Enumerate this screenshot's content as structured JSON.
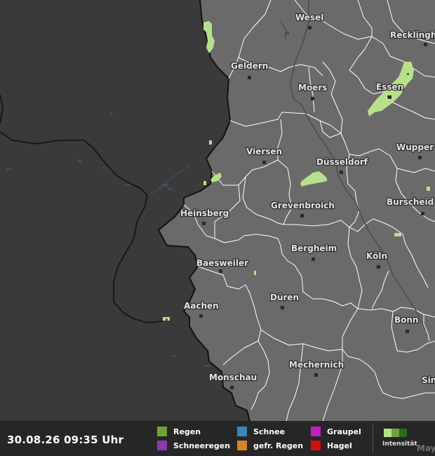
{
  "cities": [
    {
      "name": "Wesel"
    },
    {
      "name": "Recklingh"
    },
    {
      "name": "Geldern"
    },
    {
      "name": "Moers"
    },
    {
      "name": "Essen"
    },
    {
      "name": "Viersen"
    },
    {
      "name": "Düsseldorf"
    },
    {
      "name": "Wupper"
    },
    {
      "name": "Heinsberg"
    },
    {
      "name": "Grevenbroich"
    },
    {
      "name": "Burscheid"
    },
    {
      "name": "Bergheim"
    },
    {
      "name": "Köln"
    },
    {
      "name": "Baesweiler"
    },
    {
      "name": "Aachen"
    },
    {
      "name": "Düren"
    },
    {
      "name": "Bonn"
    },
    {
      "name": "Mechernich"
    },
    {
      "name": "Sin"
    },
    {
      "name": "Monschau"
    }
  ],
  "footer": {
    "timestamp": "30.08.26 09:35 Uhr",
    "legend": [
      {
        "label": "Regen",
        "color": "#6fa23a"
      },
      {
        "label": "Schnee",
        "color": "#3a86b8"
      },
      {
        "label": "Graupel",
        "color": "#c020c0"
      },
      {
        "label": "Schneeregen",
        "color": "#8a3ab0"
      },
      {
        "label": "gefr. Regen",
        "color": "#d8842a"
      },
      {
        "label": "Hagel",
        "color": "#d21010"
      }
    ],
    "intensity_label": "Intensität",
    "intensity_colors": [
      "#b5e08a",
      "#6fa23a",
      "#2e6a1a"
    ],
    "corner_city": "May"
  },
  "colors": {
    "foreign_land": "#3a3a3a",
    "germany_land": "#6a6a6a",
    "border": "#111111",
    "district_line": "#ffffff",
    "rain_light": "#b7e08c",
    "rain_dark": "#3c7a1e",
    "water": "#35506a"
  }
}
